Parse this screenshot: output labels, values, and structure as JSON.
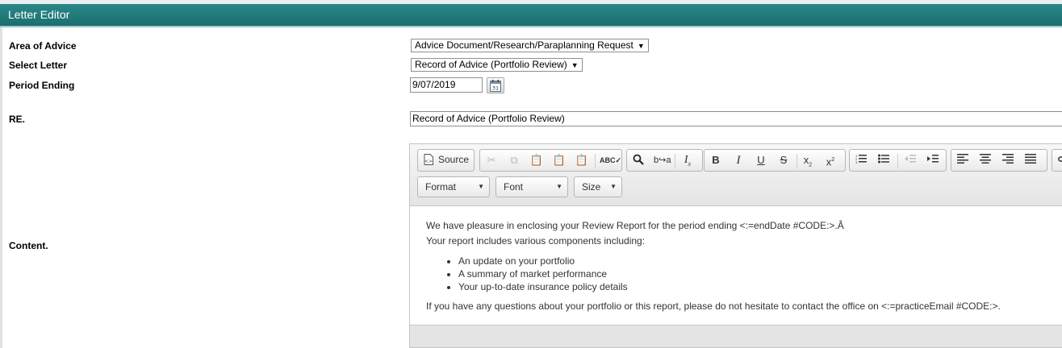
{
  "window": {
    "title": "Letter Editor"
  },
  "form": {
    "area_of_advice": {
      "label": "Area of Advice",
      "value": "Advice Document/Research/Paraplanning Request"
    },
    "select_letter": {
      "label": "Select Letter",
      "value": "Record of Advice (Portfolio Review)"
    },
    "period_ending": {
      "label": "Period Ending",
      "value": "9/07/2019"
    },
    "re": {
      "label": "RE.",
      "value": "Record of Advice (Portfolio Review)"
    },
    "content": {
      "label": "Content."
    }
  },
  "editor": {
    "toolbar": {
      "source_label": "Source",
      "format_label": "Format",
      "font_label": "Font",
      "size_label": "Size",
      "buttons": [
        "cut",
        "copy",
        "paste",
        "paste-text",
        "paste-word",
        "spell-check",
        "find",
        "replace",
        "remove-format",
        "bold",
        "italic",
        "underline",
        "strikethrough",
        "subscript",
        "superscript",
        "numbered-list",
        "bulleted-list",
        "outdent",
        "indent",
        "align-left",
        "align-center",
        "align-right",
        "justify",
        "link"
      ]
    },
    "body": {
      "line1": "We have pleasure in enclosing your Review Report for the period ending <:=endDate #CODE:>.Â",
      "line2": "Your report includes various components including:",
      "bullets": [
        "An update on your portfolio",
        "A summary of market performance",
        "Your up-to-date insurance policy details"
      ],
      "line3": "If you have any questions about your portfolio or this report, please do not hesitate to contact the office on <:=practiceEmail #CODE:>."
    }
  }
}
